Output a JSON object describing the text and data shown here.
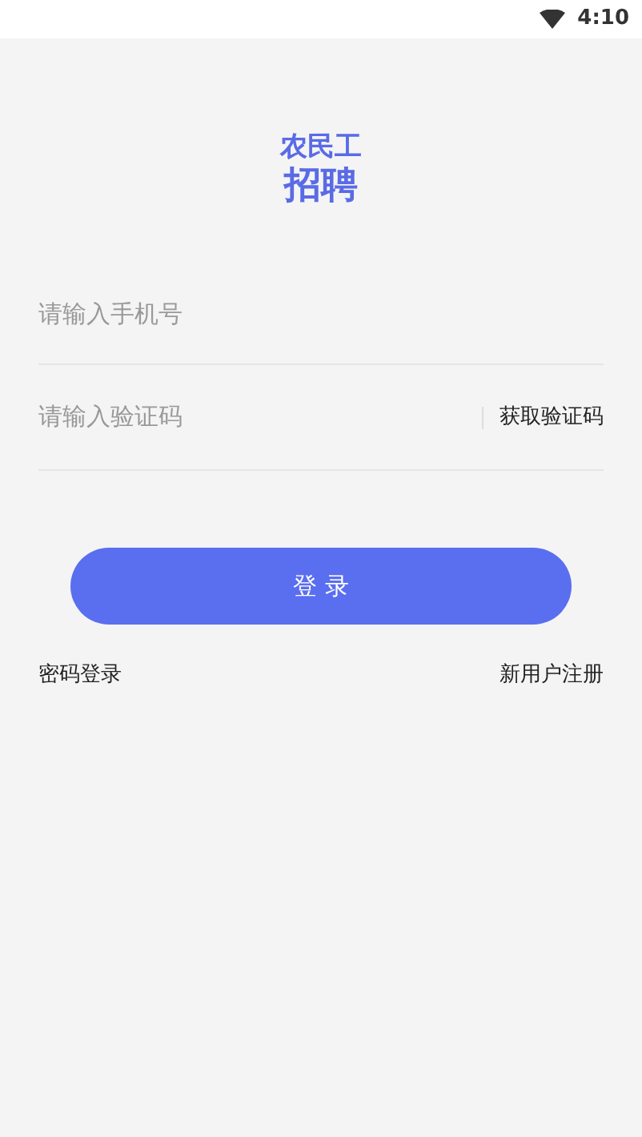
{
  "status_bar": {
    "time": "4:10"
  },
  "logo": {
    "line_1": "农民工",
    "line_2": "招聘"
  },
  "phone_field": {
    "placeholder": "请输入手机号"
  },
  "code_field": {
    "placeholder": "请输入验证码",
    "action": "获取验证码"
  },
  "login_button": "登 录",
  "links": {
    "left": "密码登录",
    "right": "新用户注册"
  }
}
